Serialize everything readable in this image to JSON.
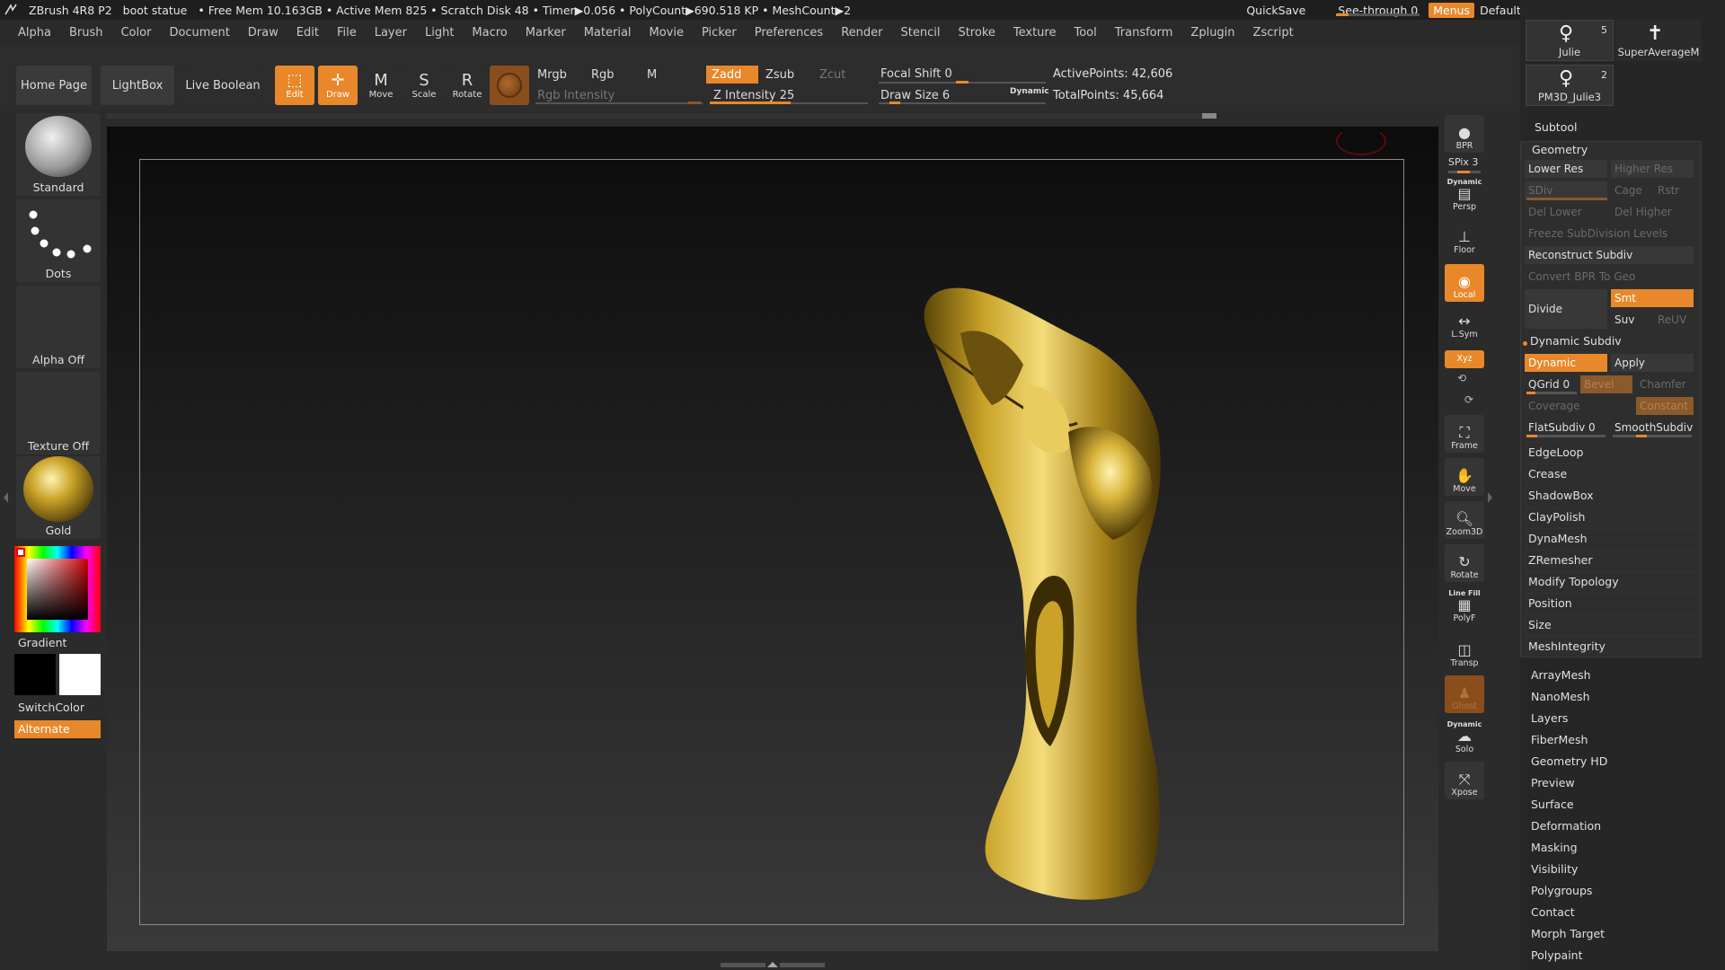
{
  "titlebar": {
    "app": "ZBrush 4R8 P2",
    "document": "boot statue",
    "stats": "• Free Mem 10.163GB • Active Mem 825 • Scratch Disk 48 • Timer▶0.056 • PolyCount▶690.518 KP • MeshCount▶2",
    "quicksave": "QuickSave",
    "see_through": "See-through  0",
    "menus": "Menus",
    "script": "DefaultZScript"
  },
  "menubar": [
    "Alpha",
    "Brush",
    "Color",
    "Document",
    "Draw",
    "Edit",
    "File",
    "Layer",
    "Light",
    "Macro",
    "Marker",
    "Material",
    "Movie",
    "Picker",
    "Preferences",
    "Render",
    "Stencil",
    "Stroke",
    "Texture",
    "Tool",
    "Transform",
    "Zplugin",
    "Zscript"
  ],
  "toolbar": {
    "home_page": "Home Page",
    "lightbox": "LightBox",
    "live_boolean": "Live Boolean",
    "edit": "Edit",
    "draw": "Draw",
    "move": "Move",
    "scale": "Scale",
    "rotate": "Rotate",
    "mrgb": "Mrgb",
    "rgb": "Rgb",
    "m": "M",
    "rgb_intensity": "Rgb Intensity",
    "zadd": "Zadd",
    "zsub": "Zsub",
    "zcut": "Zcut",
    "z_intensity": "Z Intensity 25",
    "focal_shift": "Focal Shift 0",
    "draw_size": "Draw Size 6",
    "dynamic": "Dynamic",
    "active_points": "ActivePoints: 42,606",
    "total_points": "TotalPoints: 45,664"
  },
  "leftshelf": {
    "brush": "Standard",
    "stroke": "Dots",
    "alpha": "Alpha Off",
    "texture": "Texture Off",
    "material": "Gold",
    "gradient": "Gradient",
    "switchcolor": "SwitchColor",
    "alternate": "Alternate"
  },
  "rightshelf": {
    "bpr": "BPR",
    "spix": "SPix 3",
    "dynamic": "Dynamic",
    "persp": "Persp",
    "floor": "Floor",
    "local": "Local",
    "lsym": "L.Sym",
    "xyz": "Xyz",
    "frame": "Frame",
    "move": "Move",
    "zoom3d": "Zoom3D",
    "rotate": "Rotate",
    "linefill": "Line Fill",
    "polyf": "PolyF",
    "transp": "Transp",
    "ghost": "Ghost",
    "dynamic2": "Dynamic",
    "solo": "Solo",
    "xpose": "Xpose"
  },
  "subtools": {
    "julie_num": "5",
    "julie": "Julie",
    "superavg": "SuperAverageM",
    "pm3d_num": "2",
    "pm3d": "PM3D_Julie3"
  },
  "tool_panel": {
    "subtool": "Subtool",
    "geometry": "Geometry",
    "lower_res": "Lower Res",
    "higher_res": "Higher Res",
    "sdiv": "SDiv",
    "cage": "Cage",
    "rstr": "Rstr",
    "del_lower": "Del Lower",
    "del_higher": "Del Higher",
    "freeze": "Freeze SubDivision Levels",
    "reconstruct": "Reconstruct Subdiv",
    "convert_bpr": "Convert BPR To Geo",
    "divide": "Divide",
    "smt": "Smt",
    "suv": "Suv",
    "reuv": "ReUV",
    "dynamic_subdiv": "Dynamic Subdiv",
    "dynamic": "Dynamic",
    "apply": "Apply",
    "qgrid": "QGrid 0",
    "bevel": "Bevel",
    "chamfer": "Chamfer",
    "coverage": "Coverage",
    "constant": "Constant",
    "flatsubdiv": "FlatSubdiv 0",
    "smoothsubdiv": "SmoothSubdiv",
    "geo_items": [
      "EdgeLoop",
      "Crease",
      "ShadowBox",
      "ClayPolish",
      "DynaMesh",
      "ZRemesher",
      "Modify Topology",
      "Position",
      "Size",
      "MeshIntegrity"
    ],
    "more_items": [
      "ArrayMesh",
      "NanoMesh",
      "Layers",
      "FiberMesh",
      "Geometry HD",
      "Preview",
      "Surface",
      "Deformation",
      "Masking",
      "Visibility",
      "Polygroups",
      "Contact",
      "Morph Target",
      "Polypaint"
    ]
  },
  "colors": {
    "accent": "#e8882a",
    "gold": "#c9a227"
  }
}
